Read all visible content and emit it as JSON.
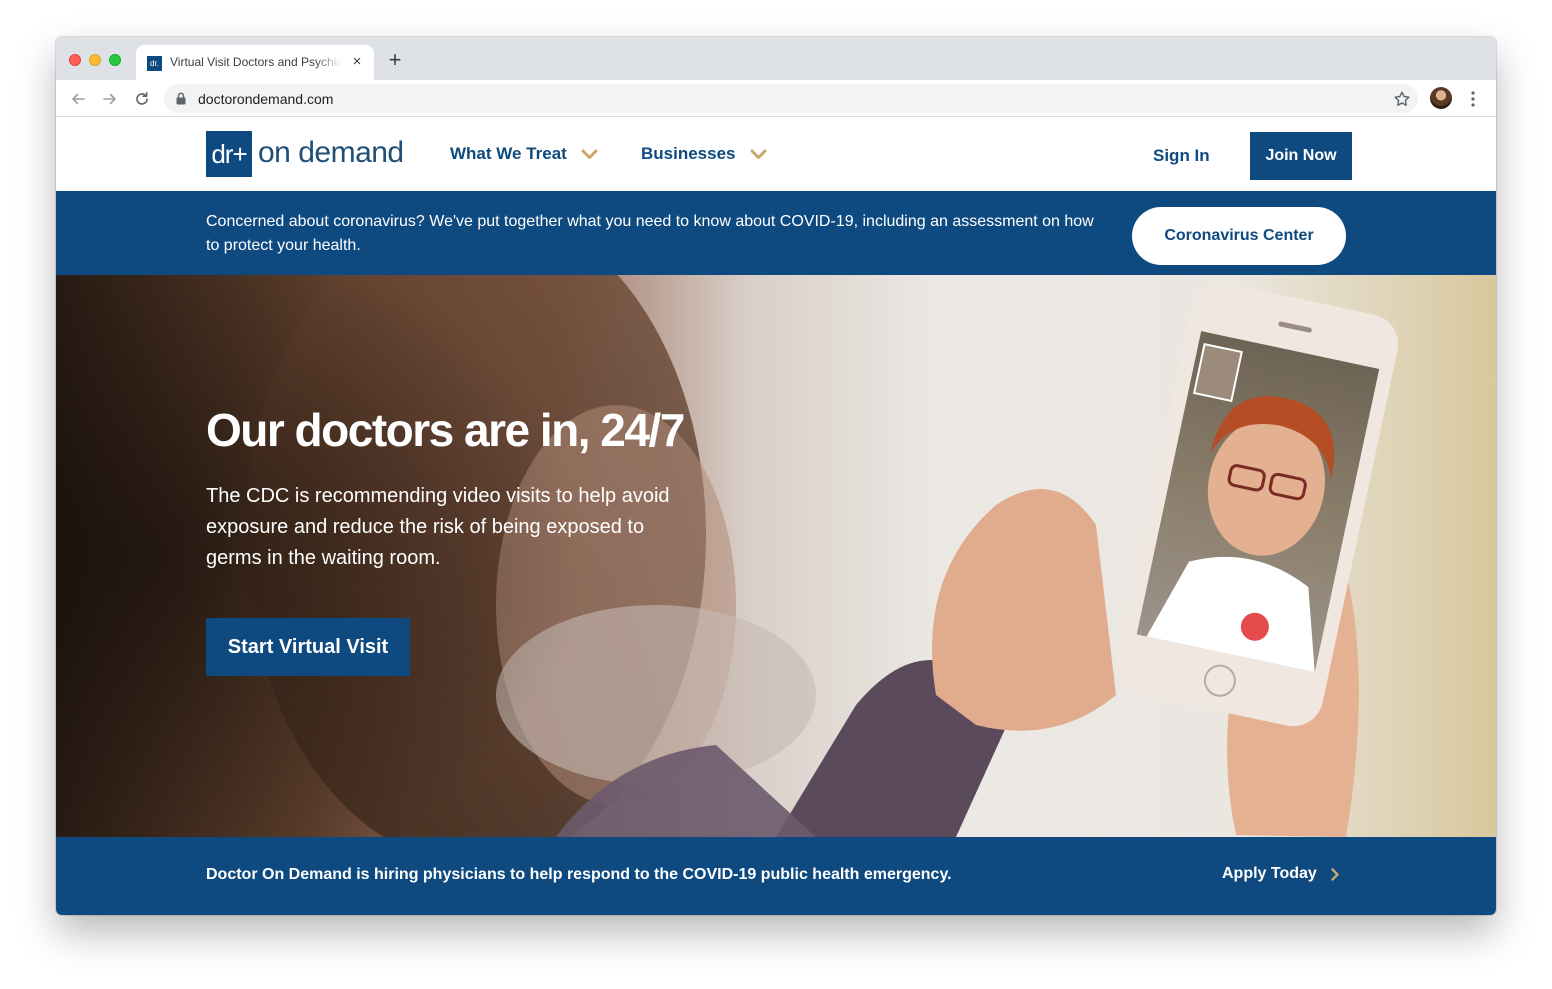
{
  "browser": {
    "tab_title": "Virtual Visit Doctors and Psychiatrists",
    "tab_favicon_text": "dr.",
    "tab_close_glyph": "×",
    "new_tab_glyph": "+",
    "url": "doctorondemand.com",
    "icons": [
      "back-icon",
      "forward-icon",
      "reload-icon",
      "lock-icon",
      "bookmark-star-icon",
      "profile-avatar",
      "menu-dots-icon",
      "close-icon",
      "new-tab-icon"
    ]
  },
  "header": {
    "logo_mark": "dr+",
    "logo_text": "on demand",
    "nav": [
      {
        "label": "What We Treat"
      },
      {
        "label": "Businesses"
      }
    ],
    "sign_in": "Sign In",
    "join_now": "Join Now"
  },
  "covid_banner": {
    "text": "Concerned about coronavirus? We've put together what you need to know about COVID-19, including an assessment on how to protect your health.",
    "button": "Coronavirus Center"
  },
  "hero": {
    "title": "Our doctors are in, 24/7",
    "body": "The CDC is recommending video visits to help avoid exposure and reduce the risk of being exposed to germs in the waiting room.",
    "cta": "Start Virtual Visit"
  },
  "hiring_banner": {
    "text": "Doctor On Demand is hiring physicians to help respond to the COVID-19 public health emergency.",
    "link": "Apply Today"
  },
  "colors": {
    "brand_blue": "#0e4a80",
    "accent_gold": "#c9a86a",
    "white": "#ffffff"
  }
}
